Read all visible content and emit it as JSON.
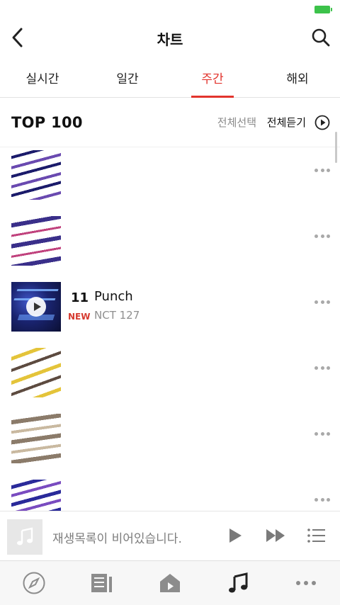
{
  "header": {
    "title": "차트"
  },
  "tabs": [
    {
      "label": "실시간",
      "active": false
    },
    {
      "label": "일간",
      "active": false
    },
    {
      "label": "주간",
      "active": true
    },
    {
      "label": "해외",
      "active": false
    }
  ],
  "section": {
    "title": "TOP 100",
    "select_all": "전체선택",
    "listen_all": "전체듣기"
  },
  "chart_items": [
    {
      "rank": "11",
      "badge": "NEW",
      "song": "Punch",
      "artist": "NCT 127"
    }
  ],
  "miniplayer": {
    "empty_text": "재생목록이 비어있습니다."
  },
  "bottom_nav": [
    "compass-icon",
    "playlist-icon",
    "home-video-icon",
    "music-note-icon",
    "more-icon"
  ],
  "colors": {
    "accent": "#e2342d",
    "badge_new": "#d63a2f",
    "battery": "#3cc24a"
  }
}
